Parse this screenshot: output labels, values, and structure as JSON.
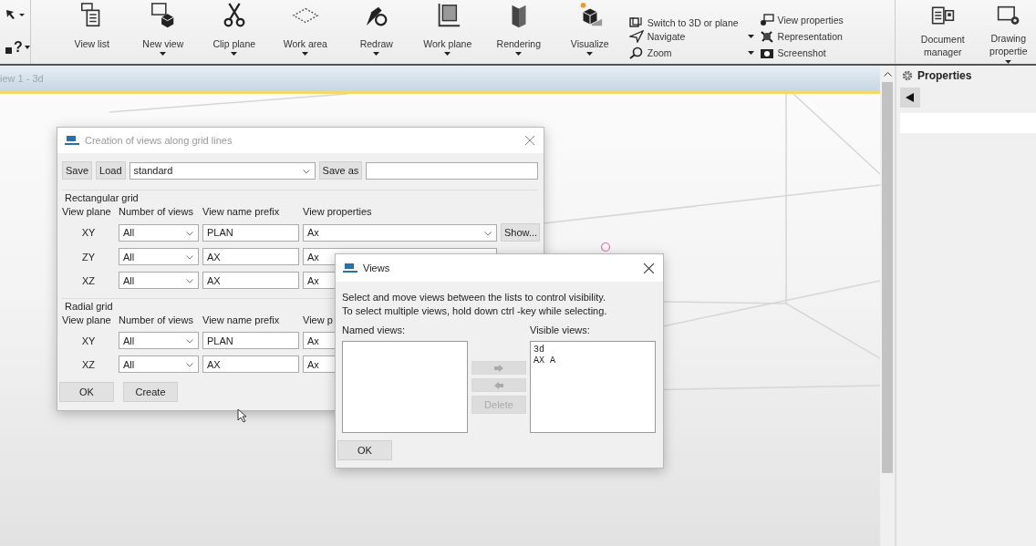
{
  "ribbon": {
    "help_symbol": "?",
    "buttons": [
      {
        "label": "View list",
        "dropdown": false
      },
      {
        "label": "New view",
        "dropdown": true
      },
      {
        "label": "Clip plane",
        "dropdown": true
      },
      {
        "label": "Work area",
        "dropdown": true
      },
      {
        "label": "Redraw",
        "dropdown": true
      },
      {
        "label": "Work plane",
        "dropdown": true
      },
      {
        "label": "Rendering",
        "dropdown": true
      },
      {
        "label": "Visualize",
        "dropdown": true
      }
    ],
    "small_group_1": [
      {
        "label": "Switch to 3D or plane"
      },
      {
        "label": "Navigate"
      },
      {
        "label": "Zoom"
      }
    ],
    "small_group_2": [
      {
        "label": "View properties",
        "dropdown": false
      },
      {
        "label": "Representation",
        "dropdown": true
      },
      {
        "label": "Screenshot",
        "dropdown": true
      }
    ],
    "right_buttons": [
      {
        "label": "Document manager",
        "dropdown": false
      },
      {
        "label": "Drawing propertie",
        "dropdown": true
      }
    ]
  },
  "view_tab": {
    "title": "iew 1 - 3d"
  },
  "properties_panel": {
    "title": "Properties"
  },
  "grid_dialog": {
    "title": "Creation of views along grid lines",
    "save": "Save",
    "load": "Load",
    "preset": "standard",
    "save_as": "Save as",
    "sections": [
      {
        "title": "Rectangular grid",
        "headers": [
          "View plane",
          "Number of views",
          "View name prefix",
          "View properties"
        ],
        "rows": [
          {
            "plane": "XY",
            "count": "All",
            "prefix": "PLAN",
            "properties": "Ax",
            "show": "Show..."
          },
          {
            "plane": "ZY",
            "count": "All",
            "prefix": "AX",
            "properties": "Ax"
          },
          {
            "plane": "XZ",
            "count": "All",
            "prefix": "AX",
            "properties": "Ax"
          }
        ]
      },
      {
        "title": "Radial grid",
        "headers": [
          "View plane",
          "Number of views",
          "View name prefix",
          "View p"
        ],
        "rows": [
          {
            "plane": "XY",
            "count": "All",
            "prefix": "PLAN",
            "properties": "Ax"
          },
          {
            "plane": "XZ",
            "count": "All",
            "prefix": "AX",
            "properties": "Ax"
          }
        ]
      }
    ],
    "ok": "OK",
    "create": "Create"
  },
  "views_dialog": {
    "title": "Views",
    "instructions": [
      "Select and move views between the lists to control visibility.",
      "To select multiple views, hold down ctrl -key while selecting."
    ],
    "named_label": "Named views:",
    "visible_label": "Visible views:",
    "visible_views": [
      "3d",
      "AX A"
    ],
    "buttons": [
      {
        "kind": "right",
        "disabled": true
      },
      {
        "kind": "left",
        "disabled": true
      },
      {
        "kind": "delete",
        "label": "Delete",
        "disabled": true
      }
    ],
    "ok": "OK"
  }
}
